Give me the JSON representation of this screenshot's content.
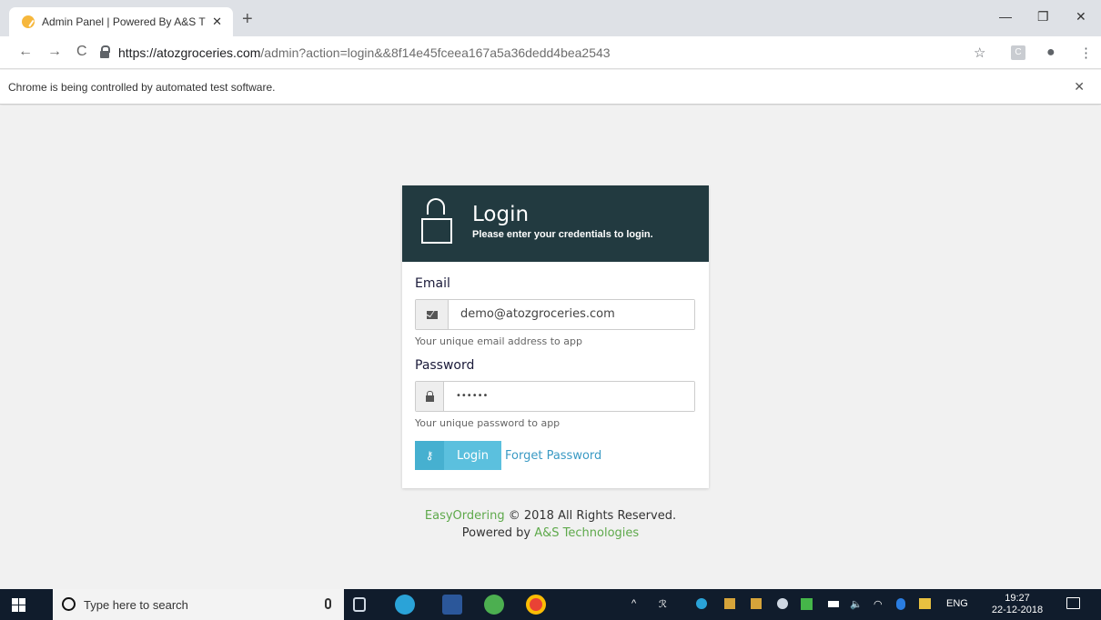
{
  "browser": {
    "tab_title": "Admin Panel | Powered By A&S T",
    "new_tab": "+",
    "close_tab": "✕",
    "url_host": "https://atozgroceries.com",
    "url_path": "/admin?action=login&&8f14e45fceea167a5a36dedd4bea2543",
    "ext_label": "C",
    "infobar_text": "Chrome is being controlled by automated test software.",
    "infobar_close": "✕"
  },
  "login": {
    "title": "Login",
    "subtitle": "Please enter your credentials to login.",
    "email_label": "Email",
    "email_value": "demo@atozgroceries.com",
    "email_help": "Your unique email address to app",
    "password_label": "Password",
    "password_value": "••••••",
    "password_help": "Your unique password to app",
    "login_button": "Login",
    "forget_link": "Forget Password"
  },
  "footer": {
    "brand": "EasyOrdering",
    "copyright": " © 2018 All Rights Reserved.",
    "powered_prefix": "Powered by ",
    "powered_by": "A&S Technologies"
  },
  "taskbar": {
    "search_placeholder": "Type here to search",
    "language": "ENG",
    "time": "19:27",
    "date": "22-12-2018"
  },
  "colors": {
    "header_bg": "#223a40",
    "button": "#5bc0de",
    "link": "#3a9ac4",
    "brand_green": "#5ea94b"
  }
}
